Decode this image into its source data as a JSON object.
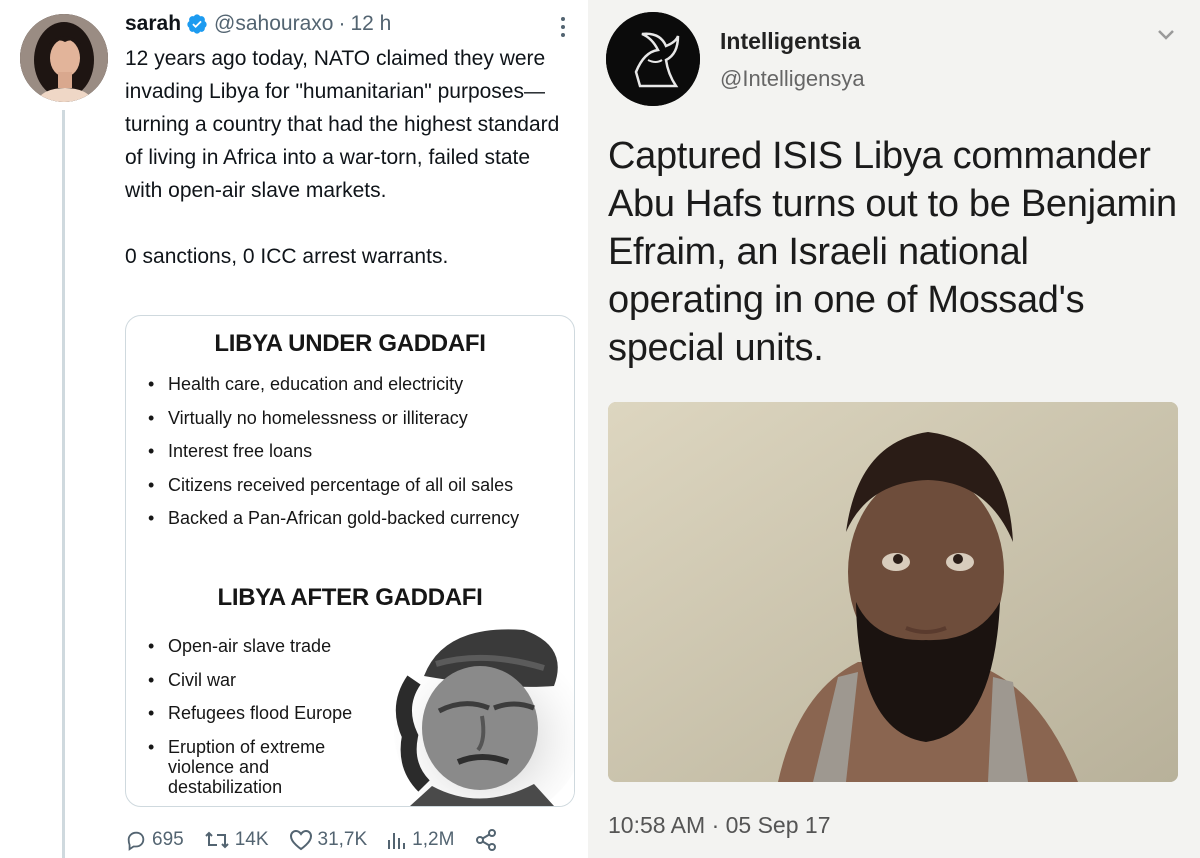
{
  "left_tweet": {
    "user_name": "sarah",
    "handle": "@sahouraxo",
    "separator": "·",
    "time": "12 h",
    "text_p1": "12 years ago today, NATO claimed they were invading Libya for \"humanitarian\" purposes—turning a country that had the highest standard of living in Africa into a war-torn, failed state with open-air slave markets.",
    "text_p2": "0 sanctions, 0 ICC arrest warrants.",
    "media": {
      "heading_before": "LIBYA UNDER GADDAFI",
      "before_items": [
        "Health care, education and electricity",
        "Virtually no homelessness or illiteracy",
        "Interest free loans",
        "Citizens received percentage of all oil sales",
        "Backed a Pan-African gold-backed currency"
      ],
      "heading_after": "LIBYA AFTER GADDAFI",
      "after_items": [
        "Open-air slave trade",
        "Civil war",
        "Refugees flood Europe",
        "Eruption of extreme violence and destabilization"
      ]
    },
    "actions": {
      "replies": "695",
      "retweets": "14K",
      "likes": "31,7K",
      "views": "1,2M"
    },
    "icons": [
      "verified-badge-icon",
      "more-icon",
      "reply-icon",
      "retweet-icon",
      "like-icon",
      "views-icon",
      "share-icon"
    ]
  },
  "right_tweet": {
    "user_name": "Intelligentsia",
    "handle": "@Intelligensya",
    "text": "Captured ISIS Libya commander Abu Hafs turns out to be Benjamin Efraim, an Israeli national operating in one of Mossad's special units.",
    "timestamp": "10:58 AM · 05 Sep 17"
  },
  "colors": {
    "verified_blue": "#1d9bf0",
    "secondary_text": "#536471",
    "border": "#cfd9de"
  }
}
